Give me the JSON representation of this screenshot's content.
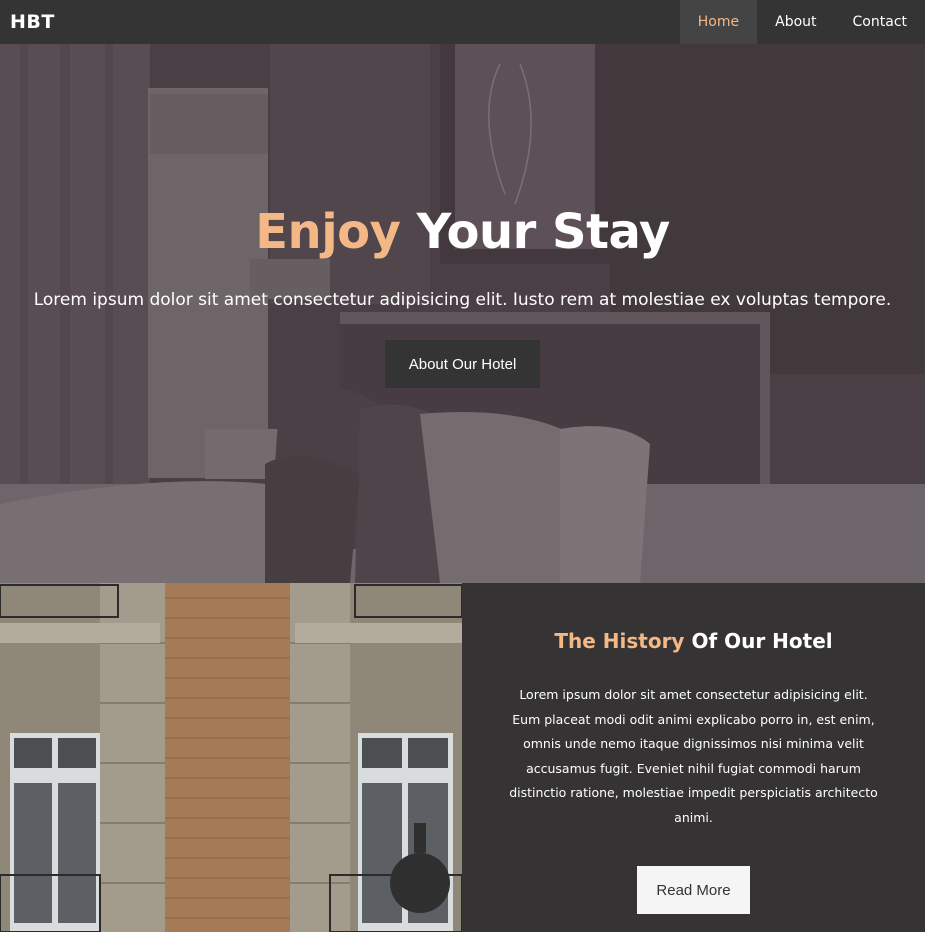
{
  "navbar": {
    "brand": "HBT",
    "links": [
      {
        "label": "Home",
        "active": true
      },
      {
        "label": "About",
        "active": false
      },
      {
        "label": "Contact",
        "active": false
      }
    ]
  },
  "hero": {
    "title_accent": "Enjoy",
    "title_rest": "Your Stay",
    "text": "Lorem ipsum dolor sit amet consectetur adipisicing elit. Iusto rem at molestiae ex voluptas tempore.",
    "button_label": "About Our Hotel"
  },
  "history": {
    "title_accent": "The History",
    "title_rest": "Of Our Hotel",
    "text": "Lorem ipsum dolor sit amet consectetur adipisicing elit. Eum placeat modi odit animi explicabo porro in, est enim, omnis unde nemo itaque dignissimos nisi minima velit accusamus fugit. Eveniet nihil fugiat commodi harum distinctio ratione, molestiae impedit perspiciatis architecto animi.",
    "button_label": "Read More"
  },
  "colors": {
    "accent": "#f3b886",
    "dark": "#343434",
    "section_bg": "#353333"
  }
}
